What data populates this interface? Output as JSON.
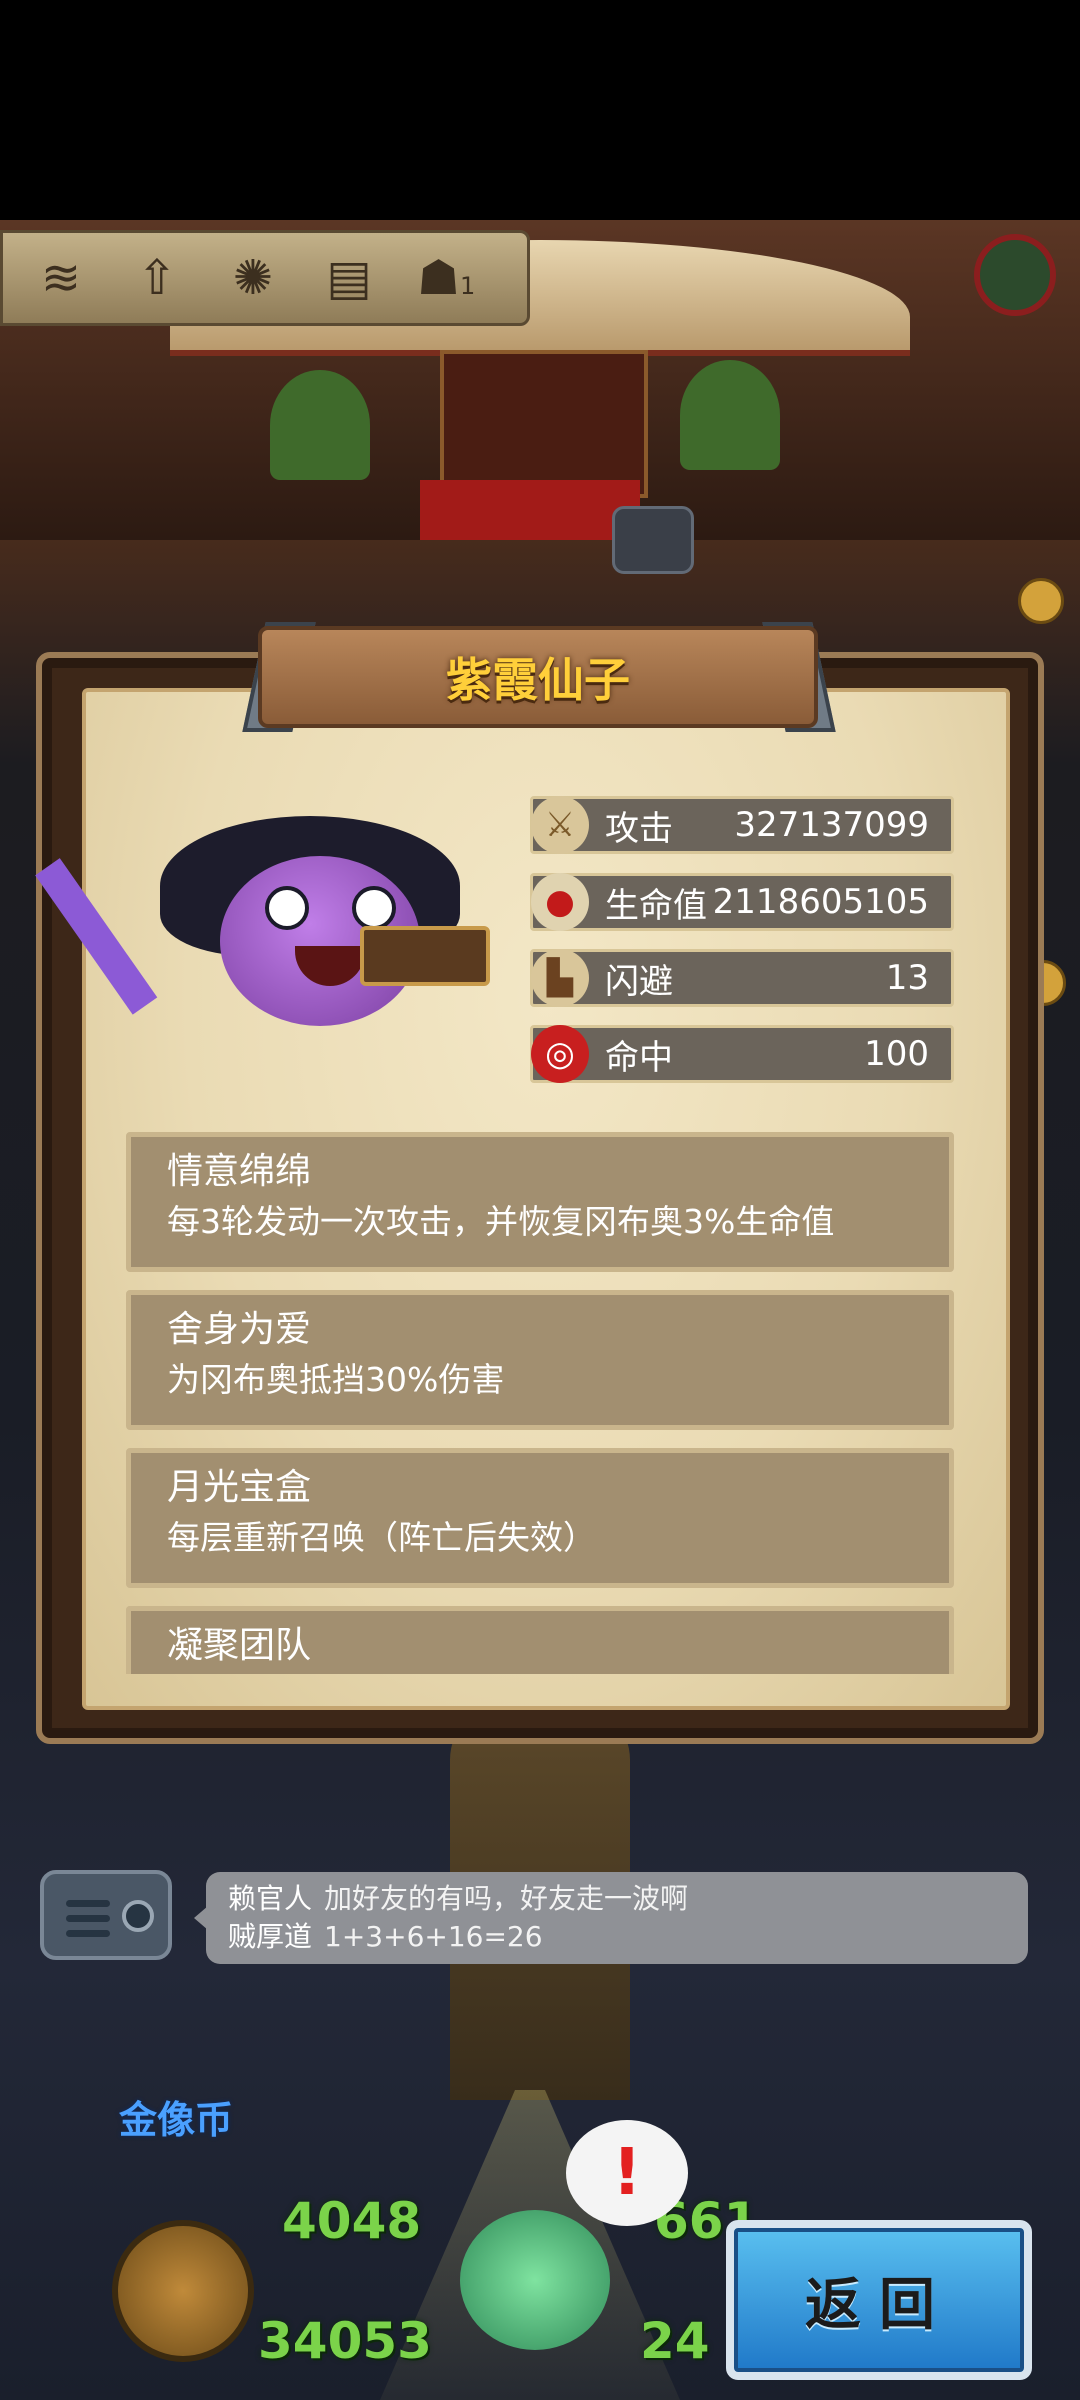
{
  "toolbar": {
    "icons": [
      "sound-wave-icon",
      "arrow-up-icon",
      "compass-icon",
      "ticket-icon",
      "figure-icon"
    ],
    "figure_count": "1"
  },
  "panel": {
    "title": "紫霞仙子",
    "stats": [
      {
        "icon": "sword-icon",
        "label": "攻击",
        "value": "327137099"
      },
      {
        "icon": "potion-icon",
        "label": "生命值",
        "value": "2118605105"
      },
      {
        "icon": "boot-icon",
        "label": "闪避",
        "value": "13"
      },
      {
        "icon": "target-icon",
        "label": "命中",
        "value": "100"
      }
    ],
    "skills": [
      {
        "name": "情意绵绵",
        "desc": "每3轮发动一次攻击，并恢复冈布奥3%生命值"
      },
      {
        "name": "舍身为爱",
        "desc": "为冈布奥抵挡30%伤害"
      },
      {
        "name": "月光宝盒",
        "desc": "每层重新召唤（阵亡后失效）"
      },
      {
        "name": "凝聚团队",
        "desc": ""
      }
    ]
  },
  "chat": {
    "lines": [
      {
        "name": "赖官人",
        "message": "加好友的有吗，好友走一波啊"
      },
      {
        "name": "贼厚道",
        "message": "1+3+6+16=26"
      }
    ]
  },
  "hud": {
    "gold_statue_label": "金像币",
    "num_a": "4048",
    "num_b": "661",
    "num_c": "34053",
    "num_d": "24"
  },
  "back_button": "返回",
  "colors": {
    "title": "#ffcf3a",
    "panel_parchment": "#eadbb4",
    "skill_box": "#a28f70",
    "stat_bar": "#6b645b",
    "back_button": "#1f78c8"
  }
}
